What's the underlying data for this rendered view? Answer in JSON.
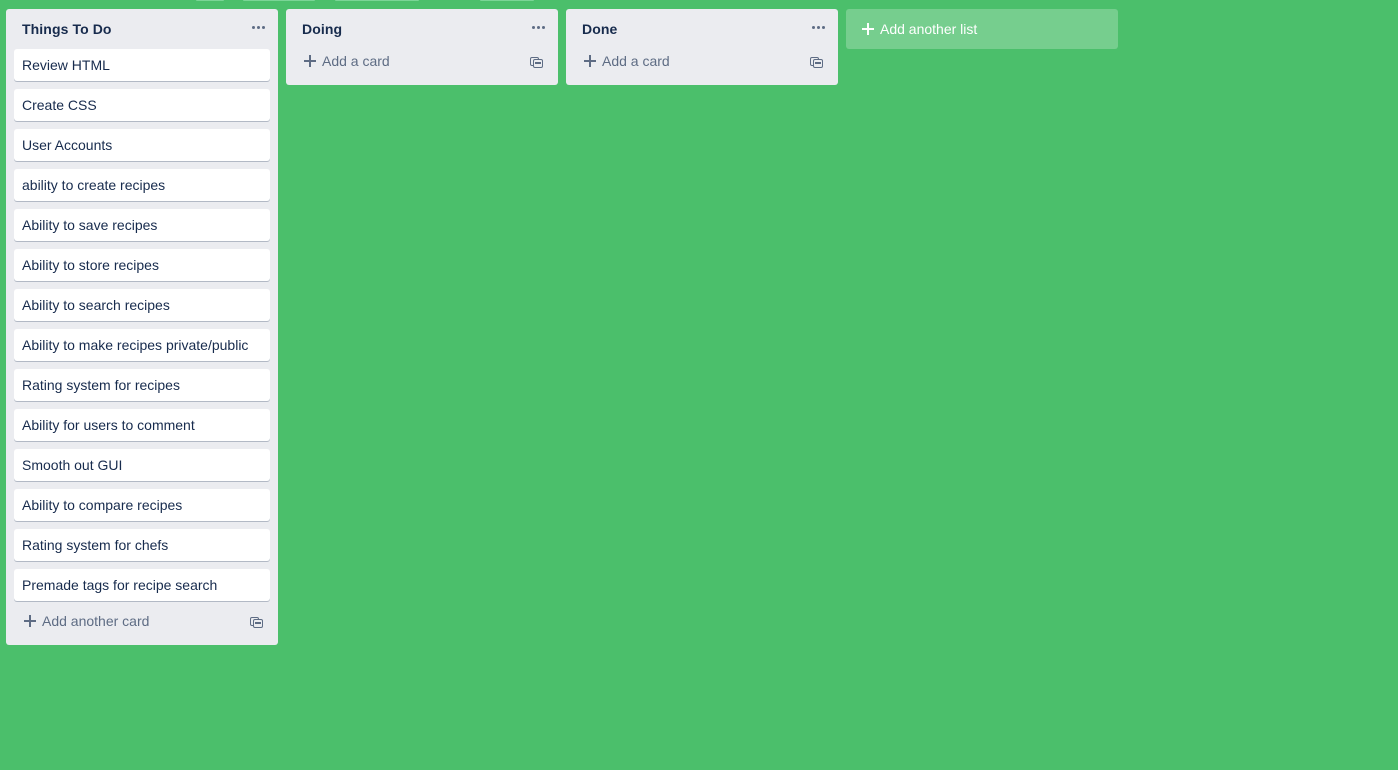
{
  "lists": [
    {
      "title": "Things To Do",
      "cards": [
        "Review HTML",
        "Create CSS",
        "User Accounts",
        "ability to create recipes",
        "Ability to save recipes",
        "Ability to store recipes",
        "Ability to search recipes",
        "Ability to make recipes private/public",
        "Rating system for recipes",
        "Ability for users to comment",
        "Smooth out GUI",
        "Ability to compare recipes",
        "Rating system for chefs",
        "Premade tags for recipe search"
      ],
      "add_label": "Add another card"
    },
    {
      "title": "Doing",
      "cards": [],
      "add_label": "Add a card"
    },
    {
      "title": "Done",
      "cards": [],
      "add_label": "Add a card"
    }
  ],
  "add_list_label": "Add another list",
  "colors": {
    "board_background": "#4bbf6b",
    "list_background": "#ebecf0",
    "card_background": "#ffffff",
    "text": "#172b4d",
    "muted_text": "#5e6c84"
  },
  "icons": {
    "list_menu": "more-horizontal-icon",
    "add": "plus-icon",
    "template": "card-template-icon"
  }
}
